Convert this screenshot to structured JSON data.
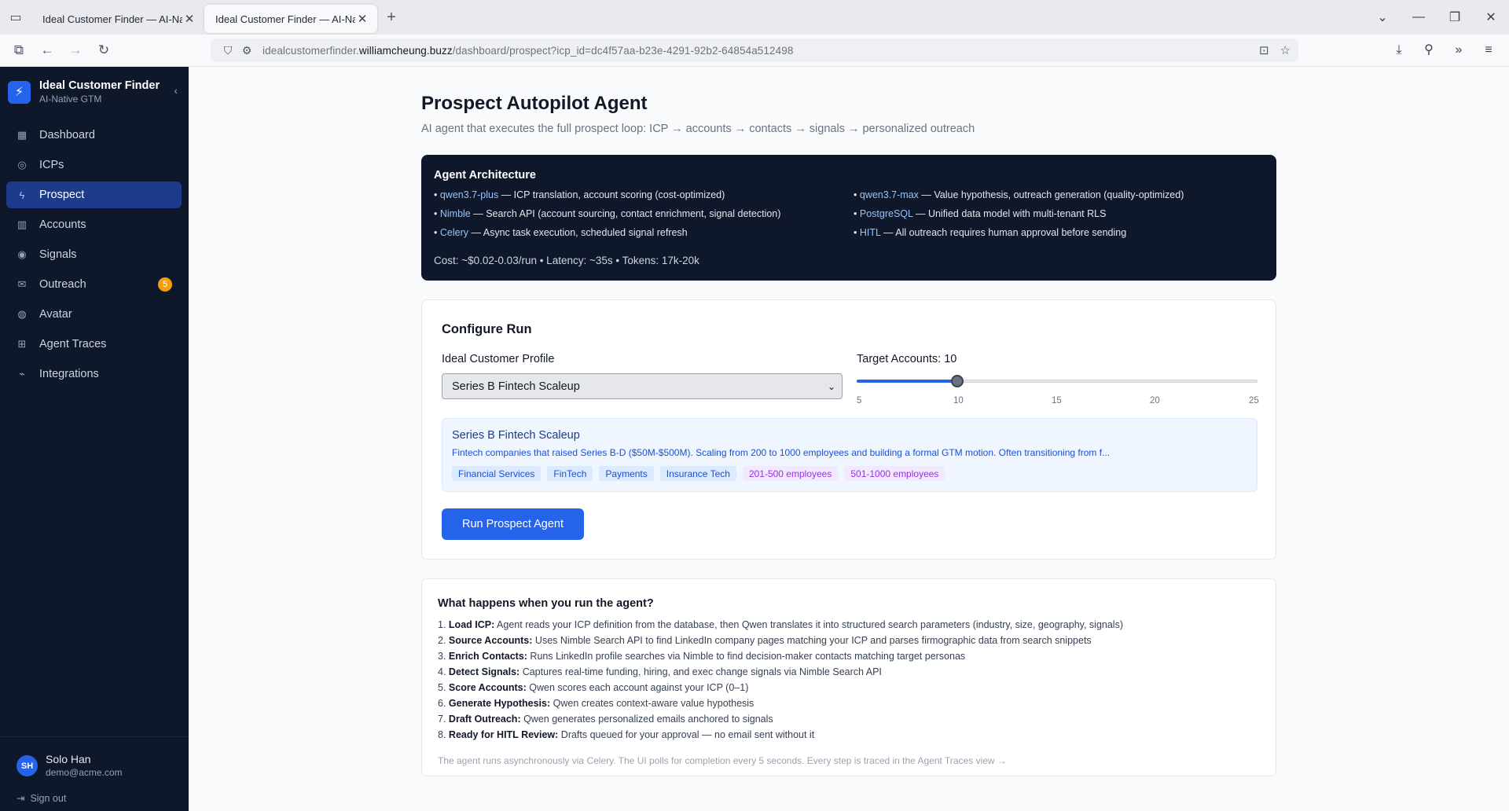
{
  "browser": {
    "tabs": [
      {
        "title": "Ideal Customer Finder — AI-Native GTM",
        "active": false
      },
      {
        "title": "Ideal Customer Finder — AI-Native GTM",
        "active": true
      }
    ],
    "url_prefix": "idealcustomerfinder.",
    "url_domain": "williamcheung.buzz",
    "url_path": "/dashboard/prospect?icp_id=dc4f57aa-b23e-4291-92b2-64854a512498"
  },
  "sidebar": {
    "brand_title": "Ideal Customer Finder",
    "brand_subtitle": "AI-Native GTM",
    "items": [
      {
        "label": "Dashboard",
        "icon": "grid-icon",
        "active": false
      },
      {
        "label": "ICPs",
        "icon": "target-icon",
        "active": false
      },
      {
        "label": "Prospect",
        "icon": "bolt-icon",
        "active": true
      },
      {
        "label": "Accounts",
        "icon": "building-icon",
        "active": false
      },
      {
        "label": "Signals",
        "icon": "radio-icon",
        "active": false
      },
      {
        "label": "Outreach",
        "icon": "mail-icon",
        "active": false,
        "badge": "5"
      },
      {
        "label": "Avatar",
        "icon": "user-circle-icon",
        "active": false
      },
      {
        "label": "Agent Traces",
        "icon": "trace-icon",
        "active": false
      },
      {
        "label": "Integrations",
        "icon": "plug-icon",
        "active": false
      }
    ],
    "user": {
      "initials": "SH",
      "name": "Solo Han",
      "email": "demo@acme.com"
    },
    "signout_label": "Sign out"
  },
  "main": {
    "title": "Prospect Autopilot Agent",
    "subtitle": "AI agent that executes the full prospect loop: ICP → accounts → contacts → signals → personalized outreach",
    "architecture": {
      "title": "Agent Architecture",
      "items": [
        {
          "key": "qwen3.7-plus",
          "text": " — ICP translation, account scoring (cost-optimized)"
        },
        {
          "key": "qwen3.7-max",
          "text": " — Value hypothesis, outreach generation (quality-optimized)"
        },
        {
          "key": "Nimble",
          "text": " — Search API (account sourcing, contact enrichment, signal detection)"
        },
        {
          "key": "PostgreSQL",
          "text": " — Unified data model with multi-tenant RLS"
        },
        {
          "key": "Celery",
          "text": " — Async task execution, scheduled signal refresh"
        },
        {
          "key": "HITL",
          "text": " — All outreach requires human approval before sending"
        }
      ],
      "cost_line": "Cost: ~$0.02-0.03/run • Latency: ~35s • Tokens: 17k-20k"
    },
    "configure": {
      "title": "Configure Run",
      "icp_label": "Ideal Customer Profile",
      "icp_selected": "Series B Fintech Scaleup",
      "target_label": "Target Accounts: 10",
      "slider": {
        "min": 5,
        "max": 25,
        "value": 10,
        "ticks": [
          "5",
          "10",
          "15",
          "20",
          "25"
        ]
      },
      "icp_card": {
        "name": "Series B Fintech Scaleup",
        "description": "Fintech companies that raised Series B-D ($50M-$500M). Scaling from 200 to 1000 employees and building a formal GTM motion. Often transitioning from f...",
        "industries": [
          "Financial Services",
          "FinTech",
          "Payments",
          "Insurance Tech"
        ],
        "sizes": [
          "201-500 employees",
          "501-1000 employees"
        ]
      },
      "run_button": "Run Prospect Agent"
    },
    "how": {
      "title": "What happens when you run the agent?",
      "steps": [
        {
          "num": "1.",
          "bold": "Load ICP:",
          "text": " Agent reads your ICP definition from the database, then Qwen translates it into structured search parameters (industry, size, geography, signals)"
        },
        {
          "num": "2.",
          "bold": "Source Accounts:",
          "text": " Uses Nimble Search API to find LinkedIn company pages matching your ICP and parses firmographic data from search snippets"
        },
        {
          "num": "3.",
          "bold": "Enrich Contacts:",
          "text": " Runs LinkedIn profile searches via Nimble to find decision-maker contacts matching target personas"
        },
        {
          "num": "4.",
          "bold": "Detect Signals:",
          "text": " Captures real-time funding, hiring, and exec change signals via Nimble Search API"
        },
        {
          "num": "5.",
          "bold": "Score Accounts:",
          "text": " Qwen scores each account against your ICP (0–1)"
        },
        {
          "num": "6.",
          "bold": "Generate Hypothesis:",
          "text": " Qwen creates context-aware value hypothesis"
        },
        {
          "num": "7.",
          "bold": "Draft Outreach:",
          "text": " Qwen generates personalized emails anchored to signals"
        },
        {
          "num": "8.",
          "bold": "Ready for HITL Review:",
          "text": " Drafts queued for your approval — no email sent without it"
        }
      ],
      "note": "The agent runs asynchronously via Celery. The UI polls for completion every 5 seconds. Every step is traced in the Agent Traces view →"
    }
  }
}
